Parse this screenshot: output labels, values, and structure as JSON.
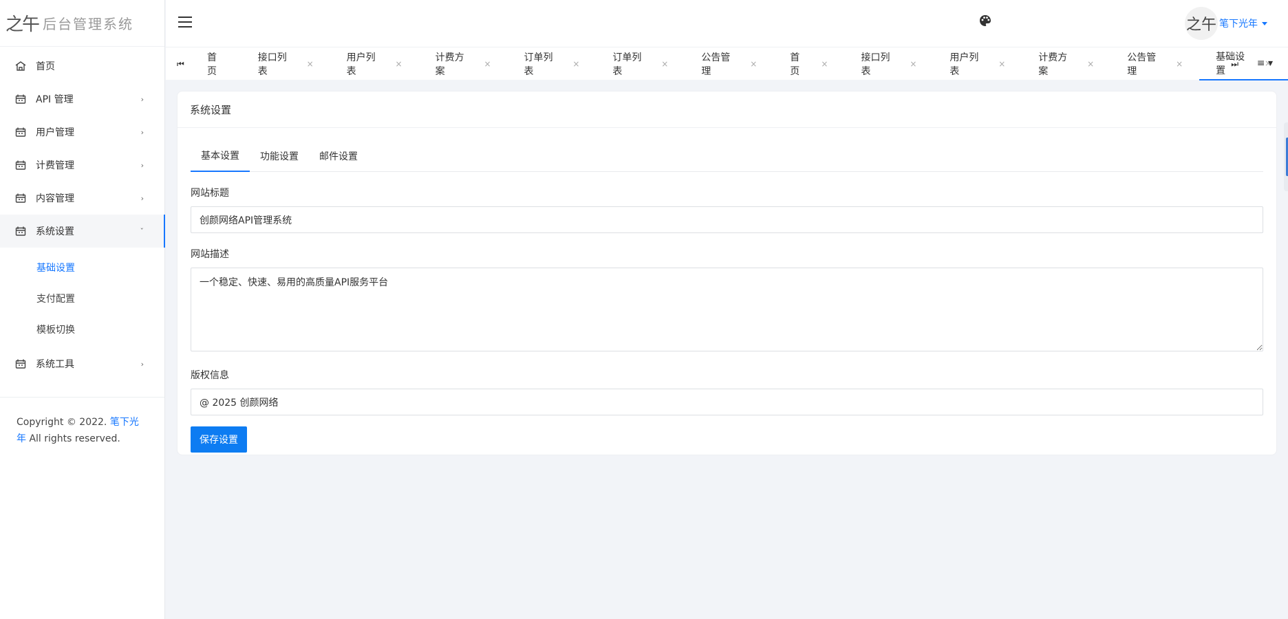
{
  "brand": {
    "logo": "之午",
    "name": "后台管理系统"
  },
  "sidebar": {
    "items": [
      {
        "label": "首页",
        "icon": "home-icon",
        "chevron": ""
      },
      {
        "label": "API 管理",
        "icon": "calendar-icon",
        "chevron": "›"
      },
      {
        "label": "用户管理",
        "icon": "calendar-icon",
        "chevron": "›"
      },
      {
        "label": "计费管理",
        "icon": "calendar-icon",
        "chevron": "›"
      },
      {
        "label": "内容管理",
        "icon": "calendar-icon",
        "chevron": "›"
      },
      {
        "label": "系统设置",
        "icon": "calendar-icon",
        "chevron": "ˇ"
      },
      {
        "label": "系统工具",
        "icon": "calendar-icon",
        "chevron": "›"
      }
    ],
    "sub_items": [
      "基础设置",
      "支付配置",
      "模板切换"
    ],
    "copyright_prefix": "Copyright © 2022.",
    "copyright_link": "笔下光年",
    "copyright_suffix": "All rights reserved."
  },
  "header": {
    "user_name": "笔下光年",
    "avatar_text": "之午",
    "icons": {
      "menu": "hamburger-menu-icon",
      "theme": "palette-icon"
    }
  },
  "tabs": {
    "prev": "⏮",
    "next": "⏭",
    "menu": "≡ ▾",
    "items": [
      {
        "label": "首页",
        "close": ""
      },
      {
        "label": "接口列表",
        "close": "×"
      },
      {
        "label": "用户列表",
        "close": "×"
      },
      {
        "label": "计费方案",
        "close": "×"
      },
      {
        "label": "订单列表",
        "close": "×"
      },
      {
        "label": "订单列表",
        "close": "×"
      },
      {
        "label": "公告管理",
        "close": "×"
      },
      {
        "label": "首页",
        "close": "×"
      },
      {
        "label": "接口列表",
        "close": "×"
      },
      {
        "label": "用户列表",
        "close": "×"
      },
      {
        "label": "计费方案",
        "close": "×"
      },
      {
        "label": "公告管理",
        "close": "×"
      },
      {
        "label": "基础设置",
        "close": "×"
      }
    ],
    "active_index": 12
  },
  "card": {
    "title": "系统设置",
    "sub_tabs": [
      "基本设置",
      "功能设置",
      "邮件设置"
    ],
    "fields": {
      "site_title_label": "网站标题",
      "site_title_value": "创颜网络API管理系统",
      "site_desc_label": "网站描述",
      "site_desc_value": "一个稳定、快速、易用的高质量API服务平台",
      "copyright_label": "版权信息",
      "copyright_value": "@ 2025 创颜网络"
    },
    "save_label": "保存设置"
  },
  "colors": {
    "accent": "#1677ff",
    "button": "#0d7cf2",
    "background": "#f2f4f8"
  }
}
